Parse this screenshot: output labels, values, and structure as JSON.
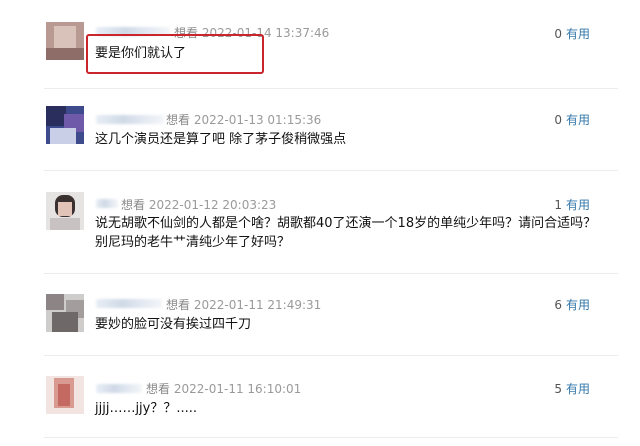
{
  "comments": [
    {
      "action": "想看",
      "time": "2022-01-14 13:37:46",
      "text": "要是你们就认了",
      "votes": "0",
      "vote_label": "有用"
    },
    {
      "action": "想看",
      "time": "2022-01-13 01:15:36",
      "text": "这几个演员还是算了吧 除了茅子俊稍微强点",
      "votes": "0",
      "vote_label": "有用"
    },
    {
      "action": "想看",
      "time": "2022-01-12 20:03:23",
      "text": "说无胡歌不仙剑的人都是个啥？胡歌都40了还演一个18岁的单纯少年吗？请问合适吗？别尼玛的老牛艹清纯少年了好吗？",
      "votes": "1",
      "vote_label": "有用"
    },
    {
      "action": "想看",
      "time": "2022-01-11 21:49:31",
      "text": "要妙的脸可没有挨过四千刀",
      "votes": "6",
      "vote_label": "有用"
    },
    {
      "action": "想看",
      "time": "2022-01-11 16:10:01",
      "text": "jjjj……jjy？？.....",
      "votes": "5",
      "vote_label": "有用"
    }
  ]
}
